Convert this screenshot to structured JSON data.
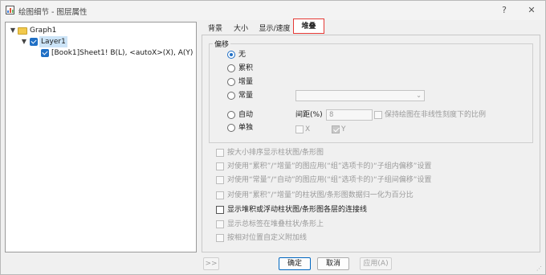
{
  "window": {
    "title": "绘图细节 - 图层属性"
  },
  "titlebar": {
    "help": "?",
    "close": "✕"
  },
  "tree": {
    "graph": "Graph1",
    "layer": "Layer1",
    "plot": "[Book1]Sheet1! B(L), <autoX>(X), A(Y) [1"
  },
  "tabs": [
    "背景",
    "大小",
    "显示/速度",
    "堆叠"
  ],
  "offset": {
    "legend": "偏移",
    "options": [
      "无",
      "累积",
      "增量",
      "常量",
      "自动",
      "单独"
    ],
    "selected": "无",
    "constant_value": "",
    "gap_label": "间距(%)",
    "gap_value": "8",
    "keep_ratio_label": "保持绘图在非线性刻度下的比例",
    "x_label": "X",
    "y_label": "Y"
  },
  "checkboxes": [
    {
      "label": "按大小排序显示柱状图/条形图",
      "enabled": false
    },
    {
      "label": "对使用“累积”/“增量”的图应用(“组”选项卡的)“子组内偏移”设置",
      "enabled": false
    },
    {
      "label": "对使用“常量”/“自动”的图应用(“组”选项卡的)“子组间偏移”设置",
      "enabled": false
    },
    {
      "label": "对使用“累积”/“增量”的柱状图/条形图数据归一化为百分比",
      "enabled": false
    },
    {
      "label": "显示堆积或浮动柱状图/条形图各层的连接线",
      "enabled": true
    },
    {
      "label": "显示总标签在堆叠柱状/条形上",
      "enabled": false
    },
    {
      "label": "按相对位置自定义附加线",
      "enabled": false
    }
  ],
  "buttons": {
    "expand": ">>",
    "ok": "确定",
    "cancel": "取消",
    "apply": "应用(A)"
  }
}
